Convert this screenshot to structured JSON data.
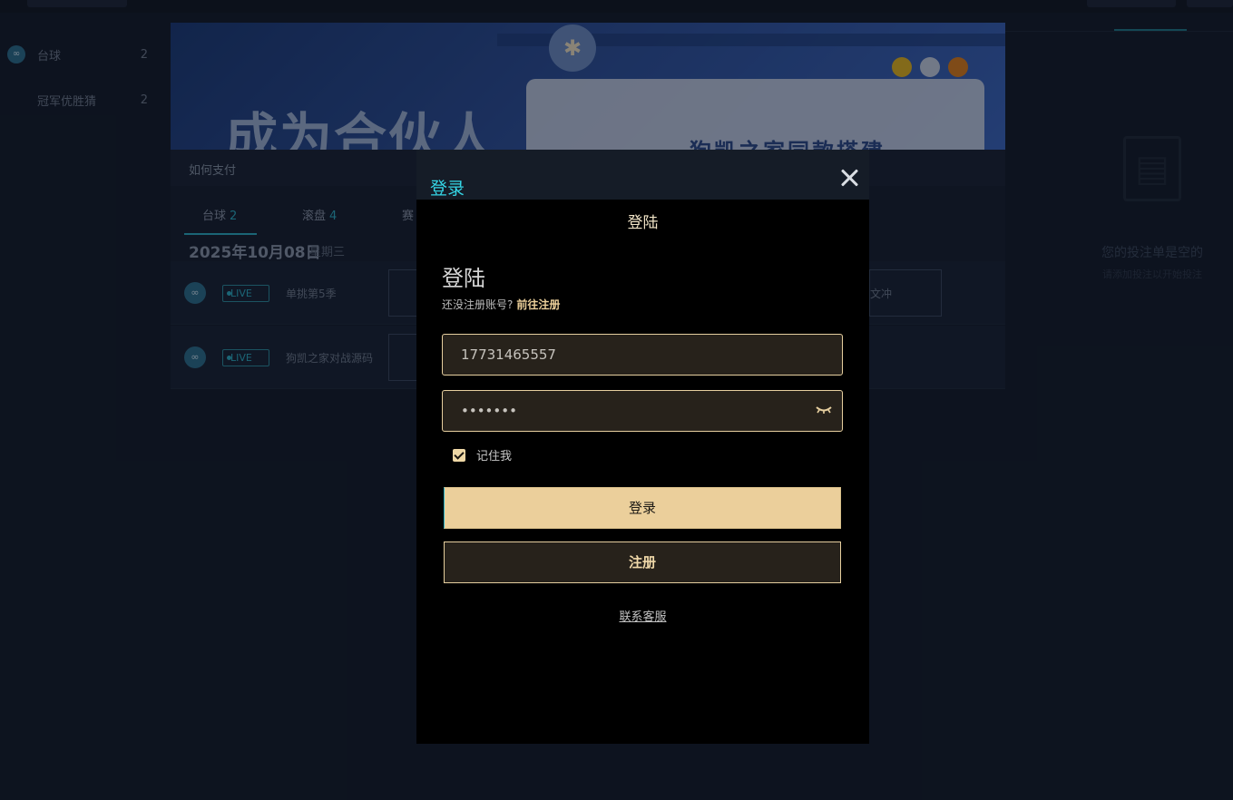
{
  "sidebar": {
    "items": [
      {
        "label": "台球",
        "count": "2",
        "icon": "cue-sport-icon"
      },
      {
        "label": "冠军优胜猜",
        "count": "2",
        "icon": ""
      }
    ]
  },
  "banner": {
    "headline": "成为合伙人",
    "subline": "狗凯之家同款搭建"
  },
  "payment_link": "如何支付",
  "tabs": [
    {
      "label": "台球",
      "count": "2"
    },
    {
      "label": "滚盘",
      "count": "4"
    },
    {
      "label": "赛",
      "count": ""
    }
  ],
  "date_header": {
    "date": "2025年10月08日",
    "weekday": "星期三"
  },
  "matches": [
    {
      "live": "LIVE",
      "name": "单挑第5季",
      "right": "文冲"
    },
    {
      "live": "LIVE",
      "name": "狗凯之家对战源码",
      "right": ""
    }
  ],
  "betslip": {
    "empty_title": "您的投注单是空的",
    "empty_hint": "请添加投注以开始投注"
  },
  "modal": {
    "title": "登录",
    "frame_title": "登陆",
    "heading": "登陆",
    "no_account_text": "还没注册账号?",
    "register_link": "前往注册",
    "phone_value": "17731465557",
    "password_value": "•••••••",
    "remember_label": "记住我",
    "remember_checked": true,
    "login_button": "登录",
    "register_button": "注册",
    "support_link": "联系客服"
  },
  "colors": {
    "accent": "#35d6e6",
    "gold": "#ebcf9b",
    "teal": "#2bb0c7"
  }
}
